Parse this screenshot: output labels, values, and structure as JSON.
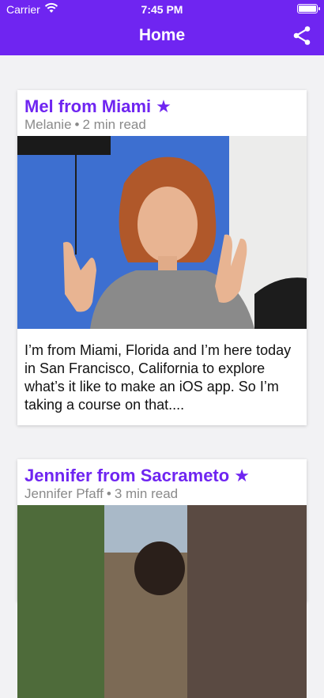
{
  "status_bar": {
    "carrier": "Carrier",
    "time": "7:45 PM"
  },
  "nav": {
    "title": "Home"
  },
  "posts": [
    {
      "title": "Mel from Miami",
      "star": "★",
      "author": "Melanie",
      "separator": "•",
      "read_time": "2 min read",
      "excerpt": "I’m from Miami, Florida and I’m here today in San Francisco, California to explore what’s it like to make an iOS app. So I’m taking a course on that...."
    },
    {
      "title": "Jennifer from Sacrameto",
      "star": "★",
      "author": "Jennifer Pfaff",
      "separator": "•",
      "read_time": "3 min read"
    }
  ],
  "colors": {
    "accent": "#6f25f1",
    "background": "#f2f2f4",
    "meta_text": "#8a8a8a"
  }
}
